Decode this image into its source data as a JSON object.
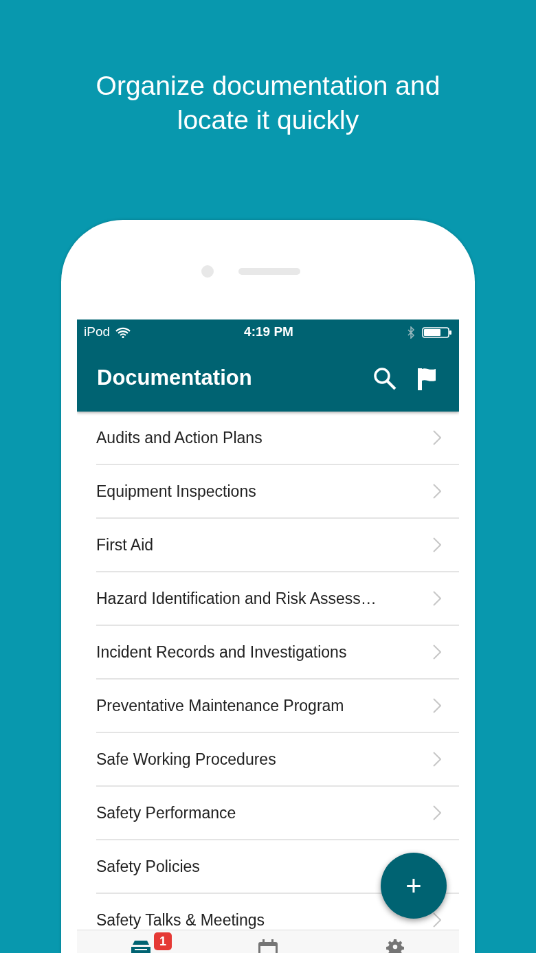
{
  "headline": "Organize documentation and locate it quickly",
  "status_bar": {
    "carrier": "iPod",
    "time": "4:19 PM"
  },
  "app_bar": {
    "title": "Documentation"
  },
  "categories": [
    {
      "label": "Audits and Action Plans"
    },
    {
      "label": "Equipment Inspections"
    },
    {
      "label": "First Aid"
    },
    {
      "label": "Hazard Identification and Risk Assess…"
    },
    {
      "label": "Incident Records and Investigations"
    },
    {
      "label": "Preventative Maintenance Program"
    },
    {
      "label": "Safe Working Procedures"
    },
    {
      "label": "Safety Performance"
    },
    {
      "label": "Safety Policies"
    },
    {
      "label": "Safety Talks & Meetings"
    }
  ],
  "fab": {
    "label": "+"
  },
  "tab_bar": {
    "tabs": [
      {
        "kind": "documents",
        "selected": true,
        "badge": "1"
      },
      {
        "kind": "calendar",
        "selected": false
      },
      {
        "kind": "settings",
        "selected": false
      }
    ]
  }
}
